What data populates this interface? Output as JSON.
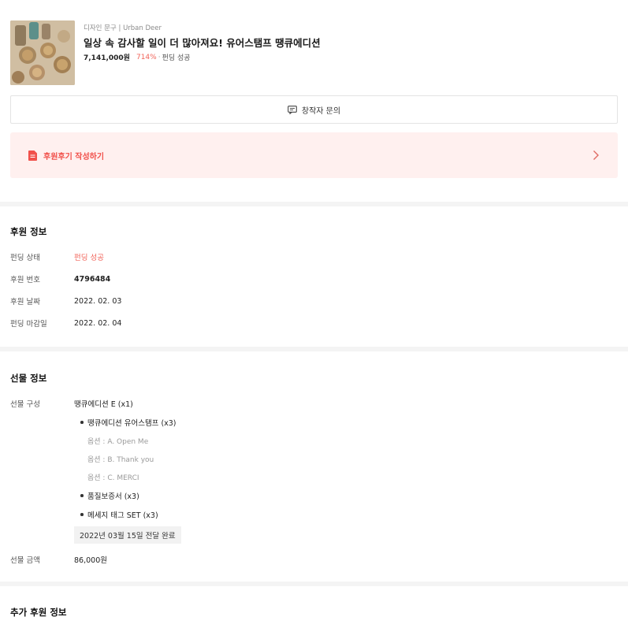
{
  "project": {
    "category": "디자인 문구 | Urban Deer",
    "title": "일상 속 감사할 일이 더 많아져요! 유어스탬프 땡큐에디션",
    "amount": "7,141,000원",
    "percent": "714%",
    "separator": "·",
    "status": "펀딩 성공"
  },
  "inquiry_label": "창작자 문의",
  "review_label": "후원후기 작성하기",
  "pledge": {
    "title": "후원 정보",
    "rows": [
      {
        "label": "펀딩 상태",
        "value": "펀딩 성공"
      },
      {
        "label": "후원 번호",
        "value": "4796484"
      },
      {
        "label": "후원 날짜",
        "value": "2022. 02. 03"
      },
      {
        "label": "펀딩 마감일",
        "value": "2022. 02. 04"
      }
    ]
  },
  "gift": {
    "title": "선물 정보",
    "composition_label": "선물 구성",
    "reward_name": "땡큐에디션 E (x1)",
    "items": [
      {
        "name": "땡큐에디션 유어스탬프 (x3)",
        "options": [
          "옵션 : A. Open Me",
          "옵션 : B. Thank you",
          "옵션 : C. MERCI"
        ]
      },
      {
        "name": "품질보증서 (x3)"
      },
      {
        "name": "메세지 태그 SET (x3)"
      }
    ],
    "delivery": "2022년 03월 15일 전달 완료",
    "amount_label": "선물 금액",
    "amount": "86,000원"
  },
  "extra": {
    "title": "추가 후원 정보"
  }
}
